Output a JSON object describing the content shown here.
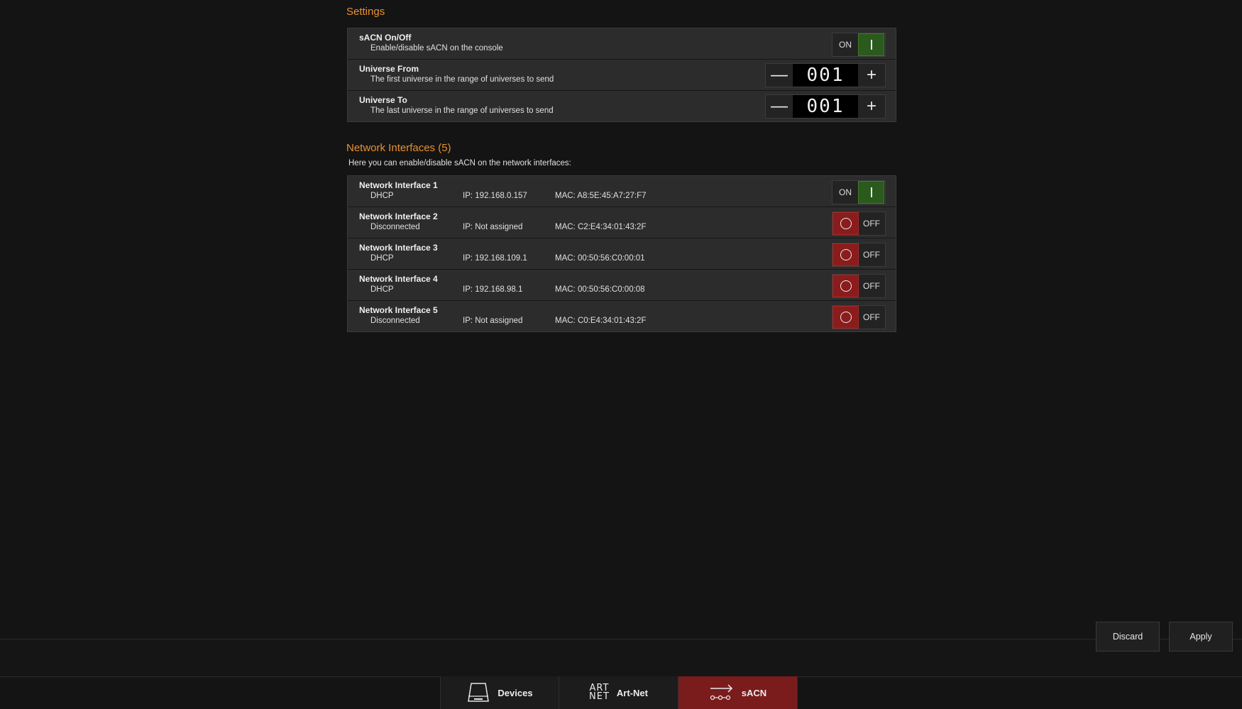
{
  "settings": {
    "title": "Settings",
    "sacn": {
      "title": "sACN On/Off",
      "desc": "Enable/disable sACN on the console",
      "state_label": "ON",
      "state": "on"
    },
    "universe_from": {
      "title": "Universe From",
      "desc": "The first universe in the range of universes to send",
      "value": "001",
      "minus": "—",
      "plus": "+"
    },
    "universe_to": {
      "title": "Universe To",
      "desc": "The last universe in the range of universes to send",
      "value": "001",
      "minus": "—",
      "plus": "+"
    }
  },
  "network": {
    "title": "Network Interfaces (5)",
    "intro": "Here you can enable/disable sACN on the network interfaces:",
    "interfaces": [
      {
        "name": "Network Interface 1",
        "mode": "DHCP",
        "ip": "IP: 192.168.0.157",
        "mac": "MAC: A8:5E:45:A7:27:F7",
        "state_label": "ON",
        "state": "on"
      },
      {
        "name": "Network Interface 2",
        "mode": "Disconnected",
        "ip": "IP: Not assigned",
        "mac": "MAC: C2:E4:34:01:43:2F",
        "state_label": "OFF",
        "state": "off"
      },
      {
        "name": "Network Interface 3",
        "mode": "DHCP",
        "ip": "IP: 192.168.109.1",
        "mac": "MAC: 00:50:56:C0:00:01",
        "state_label": "OFF",
        "state": "off"
      },
      {
        "name": "Network Interface 4",
        "mode": "DHCP",
        "ip": "IP: 192.168.98.1",
        "mac": "MAC: 00:50:56:C0:00:08",
        "state_label": "OFF",
        "state": "off"
      },
      {
        "name": "Network Interface 5",
        "mode": "Disconnected",
        "ip": "IP: Not assigned",
        "mac": "MAC: C0:E4:34:01:43:2F",
        "state_label": "OFF",
        "state": "off"
      }
    ]
  },
  "footer": {
    "discard": "Discard",
    "apply": "Apply"
  },
  "tabs": [
    {
      "label": "Devices",
      "icon": "devices-icon"
    },
    {
      "label": "Art-Net",
      "icon": "artnet-icon",
      "icon_text_top": "ART",
      "icon_text_bottom": "NET"
    },
    {
      "label": "sACN",
      "icon": "sacn-icon",
      "active": true
    }
  ],
  "colors": {
    "accent": "#e8912f",
    "on": "#2a5a1c",
    "off": "#8a1c1c",
    "active_tab": "#7a1c1c"
  }
}
